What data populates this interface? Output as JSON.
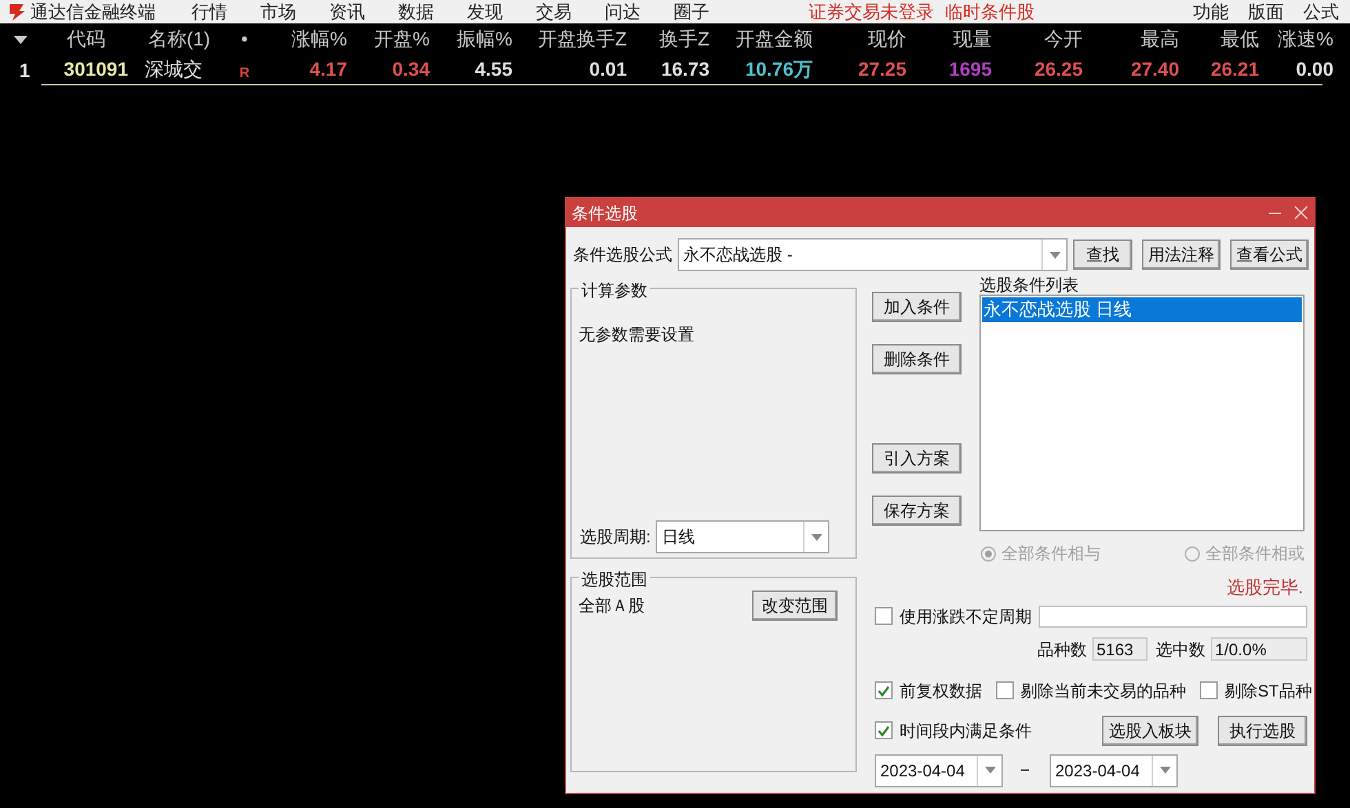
{
  "menu_bar": {
    "app_title": "通达信金融终端",
    "items": [
      "行情",
      "市场",
      "资讯",
      "数据",
      "发现",
      "交易",
      "问达",
      "圈子"
    ],
    "status_texts": [
      "证券交易未登录",
      "临时条件股"
    ],
    "right_items": [
      "功能",
      "版面",
      "公式"
    ]
  },
  "table": {
    "columns": [
      "代码",
      "名称(1)",
      "•",
      "涨幅%",
      "开盘%",
      "振幅%",
      "开盘换手Z",
      "换手Z",
      "开盘金额",
      "现价",
      "现量",
      "今开",
      "最高",
      "最低",
      "涨速%"
    ],
    "rows": [
      {
        "index": "1",
        "cells": [
          {
            "text": "301091",
            "color": "#e8e8a8"
          },
          {
            "text": "深城交",
            "color": "#e0e0e0"
          },
          {
            "text": "R",
            "color": "#e04040"
          },
          {
            "text": "4.17",
            "color": "#e05050"
          },
          {
            "text": "0.34",
            "color": "#e05050"
          },
          {
            "text": "4.55",
            "color": "#e0e0e0"
          },
          {
            "text": "0.01",
            "color": "#e0e0e0"
          },
          {
            "text": "16.73",
            "color": "#e0e0e0"
          },
          {
            "text": "10.76万",
            "color": "#50c0d0"
          },
          {
            "text": "27.25",
            "color": "#e05050"
          },
          {
            "text": "1695",
            "color": "#b040c0"
          },
          {
            "text": "26.25",
            "color": "#e05050"
          },
          {
            "text": "27.40",
            "color": "#e05050"
          },
          {
            "text": "26.21",
            "color": "#e05050"
          },
          {
            "text": "0.00",
            "color": "#e0e0e0"
          }
        ]
      }
    ]
  },
  "dialog": {
    "title": "条件选股",
    "formula_label": "条件选股公式",
    "formula_value": "永不恋战选股  -",
    "top_buttons": [
      "查找",
      "用法注释",
      "查看公式"
    ],
    "params_group": {
      "title": "计算参数",
      "message": "无参数需要设置",
      "period_label": "选股周期:",
      "period_value": "日线"
    },
    "range_group": {
      "title": "选股范围",
      "value": "全部Ａ股",
      "button": "改变范围"
    },
    "action_buttons": [
      "加入条件",
      "删除条件",
      "引入方案",
      "保存方案"
    ],
    "conditions": {
      "title": "选股条件列表",
      "items": [
        {
          "text": "永不恋战选股  日线",
          "selected": true
        }
      ]
    },
    "logic_options": [
      {
        "label": "全部条件相与",
        "selected": true,
        "disabled": true
      },
      {
        "label": "全部条件相或",
        "selected": false,
        "disabled": true
      }
    ],
    "status_message": "选股完毕.",
    "variable_period": {
      "label": "使用涨跌不定周期",
      "checked": false
    },
    "counts": [
      {
        "label": "品种数",
        "value": "5163"
      },
      {
        "label": "选中数",
        "value": "1/0.0%"
      }
    ],
    "options": [
      {
        "label": "前复权数据",
        "checked": true
      },
      {
        "label": "剔除当前未交易的品种",
        "checked": false
      },
      {
        "label": "剔除ST品种",
        "checked": false
      }
    ],
    "time_range": {
      "label": "时间段内满足条件",
      "checked": true,
      "start": "2023-04-04",
      "end": "2023-04-04"
    },
    "bottom_buttons": [
      "选股入板块",
      "执行选股"
    ]
  }
}
